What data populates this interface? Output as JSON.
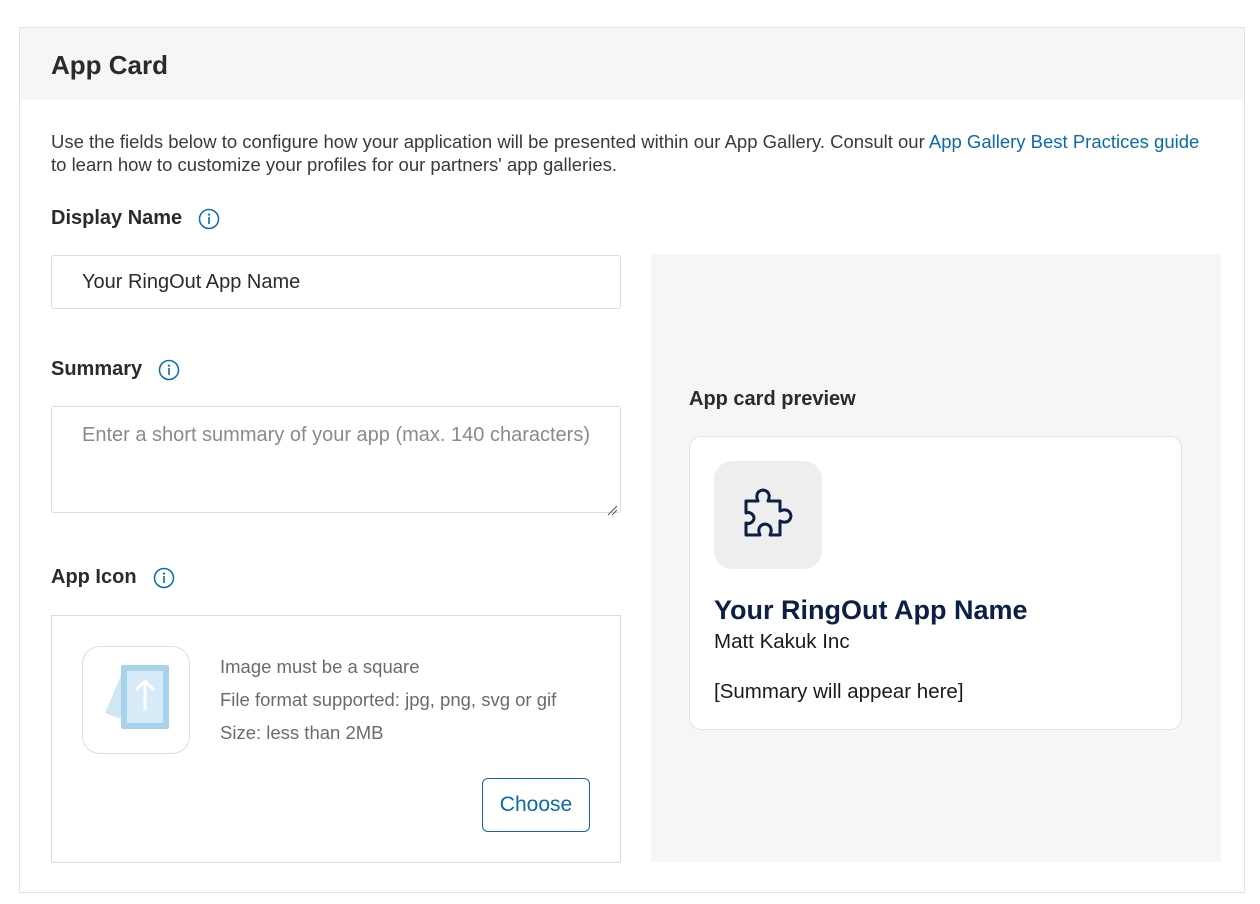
{
  "section": {
    "title": "App Card",
    "intro_text": "Use the fields below to configure how your application will be presented within our App Gallery. Consult our ",
    "intro_link": "App Gallery Best Practices guide",
    "intro_tail": " to learn how to customize your profiles for our partners' app galleries."
  },
  "display_name": {
    "label": "Display Name",
    "value": "Your RingOut App Name",
    "info_icon": "info-circle-icon"
  },
  "summary": {
    "label": "Summary",
    "placeholder": "Enter a short summary of your app (max. 140 characters)",
    "value": "",
    "info_icon": "info-circle-icon"
  },
  "app_icon": {
    "label": "App Icon",
    "info_icon": "info-circle-icon",
    "upload_icon": "image-upload-icon",
    "requirements": [
      "Image must be a square",
      "File format supported: jpg, png, svg or gif",
      "Size: less than 2MB"
    ],
    "choose_label": "Choose"
  },
  "preview": {
    "label": "App card preview",
    "icon": "puzzle-piece-icon",
    "app_name": "Your RingOut App Name",
    "company": "Matt Kakuk Inc",
    "summary": "[Summary will appear here]"
  },
  "colors": {
    "link": "#0a6ba8",
    "preview_title": "#0d1f44",
    "panel_bg": "#f6f6f6"
  }
}
